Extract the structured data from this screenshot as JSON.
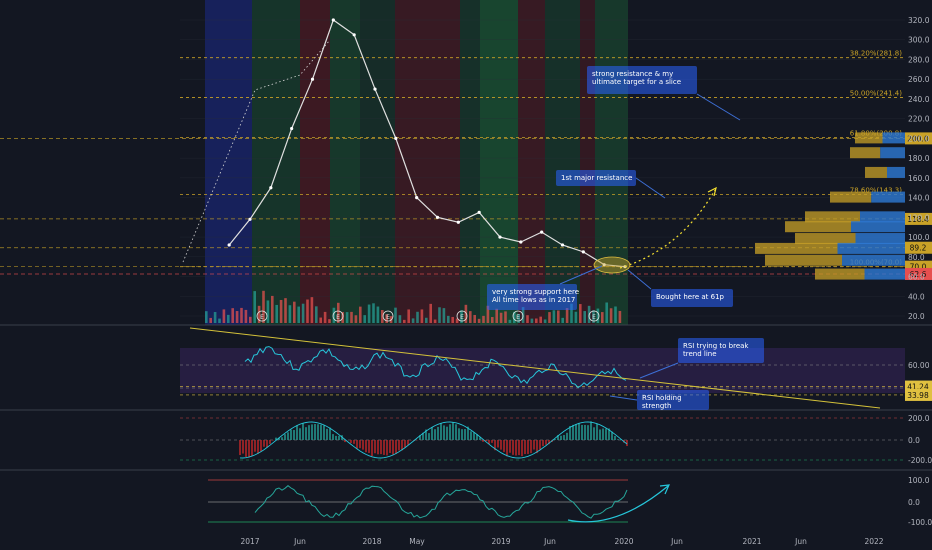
{
  "colors": {
    "background": "#131722",
    "axis_text": "#b2b5be",
    "grid": "#2a2e39",
    "fib_line": "#c9a227",
    "price_line": "#e64f4f",
    "rsi_line": "#26c6da",
    "trendline": "#d4c23a",
    "annotation_bg": "#2962ff",
    "band_blue": "#1b2a8a",
    "band_green": "#1e6b3a",
    "band_red": "#7a1f24"
  },
  "chart_data": [
    {
      "type": "line",
      "pane": "price",
      "x_ticks": [
        "2017",
        "Jun",
        "2018",
        "May",
        "2019",
        "Jun",
        "2020",
        "Jun",
        "2021",
        "Jun",
        "2022"
      ],
      "y_ticks": [
        20,
        40,
        60,
        80,
        100,
        120,
        140,
        160,
        180,
        200,
        220,
        240,
        260,
        280,
        300,
        320
      ],
      "ylim": [
        10,
        330
      ],
      "series": [
        {
          "x": [
            "2016-11",
            "2017-01",
            "2017-03",
            "2017-05",
            "2017-07",
            "2017-09",
            "2017-11",
            "2018-01",
            "2018-03",
            "2018-05",
            "2018-07",
            "2018-09",
            "2018-11",
            "2019-01",
            "2019-03",
            "2019-05",
            "2019-07",
            "2019-09",
            "2019-11",
            "2020-01"
          ],
          "values": [
            92,
            118,
            150,
            210,
            260,
            320,
            305,
            250,
            200,
            140,
            120,
            115,
            125,
            100,
            95,
            105,
            92,
            85,
            72,
            70
          ]
        }
      ],
      "levels": [
        {
          "label": "38.20%(281.8)",
          "value": 281.8
        },
        {
          "label": "50.00%(241.4)",
          "value": 241.4
        },
        {
          "label": "61.80%(200.8)",
          "value": 200.8
        },
        {
          "label": "78.60%(143.3)",
          "value": 143.3
        },
        {
          "label": "100.00%(70.0)",
          "value": 70.0
        }
      ],
      "price_labels": [
        {
          "text": "200.0",
          "value": 200.0
        },
        {
          "text": "118.4",
          "value": 118.4
        },
        {
          "text": "89.2",
          "value": 89.2
        },
        {
          "text": "70.0",
          "value": 70.0
        },
        {
          "text": "62.6",
          "value": 62.6
        }
      ],
      "annotations": [
        {
          "text": [
            "strong resistance & my",
            "ultimate target for a slice"
          ]
        },
        {
          "text": [
            "1st major resistance"
          ]
        },
        {
          "text": [
            "very strong support here",
            "All time lows as in 2017"
          ]
        },
        {
          "text": [
            "Bought here at 61p"
          ]
        }
      ]
    },
    {
      "type": "line",
      "pane": "rsi",
      "y_ticks": [
        60.0,
        40.0
      ],
      "value_labels": [
        "41.24",
        "33.98"
      ],
      "annotations": [
        {
          "text": [
            "RSI trying to break",
            "trend line"
          ]
        },
        {
          "text": [
            "RSI holding",
            "strength"
          ]
        }
      ]
    },
    {
      "type": "area",
      "pane": "oscillator",
      "y_ticks": [
        "200.0",
        "0.0",
        "-200.0"
      ]
    },
    {
      "type": "area",
      "pane": "wave",
      "y_ticks": [
        "100.0",
        "0.0",
        "-100.0"
      ]
    }
  ]
}
